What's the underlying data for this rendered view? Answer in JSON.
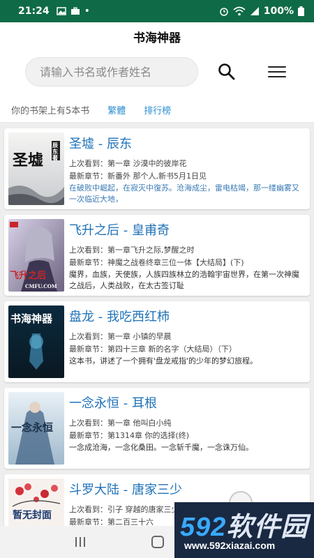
{
  "status_bar": {
    "time": "21:24",
    "battery": "100%",
    "dot": "•"
  },
  "app": {
    "title": "书海神器"
  },
  "search": {
    "placeholder": "请输入书名或作者姓名"
  },
  "shelf": {
    "count_text": "你的书架上有5本书",
    "traditional": "繁體",
    "ranking": "排行榜"
  },
  "books": [
    {
      "title": "圣墟 - 辰东",
      "last_read": "上次看到：第一章 沙漠中的彼岸花",
      "latest": "最新章节：新番外 那个人,新书5月1日见",
      "desc": "在破败中崛起，在寂灭中復苏。沧海成尘，雷电枯竭，那一缕幽雾又一次临近大地，",
      "cover_text": "圣墟",
      "cover_sub": "辰东著"
    },
    {
      "title": "飞升之后 - 皇甫奇",
      "last_read": "上次看到：第一章飞升之际,梦醒之时",
      "latest": "最新章节：神魔之战卷终章三位一体【大结局】(下)",
      "desc": "魔界，血族，天使族，人族四族林立的浩翰宇宙世界，在第一次神魔之战后，人类战败，在太古签订耻",
      "cover_text": "飞升之后",
      "cover_sub": "CMFU.COM"
    },
    {
      "title": "盘龙 - 我吃西红柿",
      "last_read": "上次看到：第一章 小镇的早晨",
      "latest": "最新章节：第四十三章 新的名字（大结局）（下）",
      "desc": "这本书，讲述了一个拥有'盘龙戒指'的少年的梦幻旅程。",
      "cover_text": "书海神器"
    },
    {
      "title": "一念永恒 - 耳根",
      "last_read": "上次看到：第一章 他叫白小纯",
      "latest": "最新章节：第1314章 你的选择(终)",
      "desc": "一念成沧海，一念化桑田。一念斩千魔，一念诛万仙。",
      "cover_text": "一念永恒"
    },
    {
      "title": "斗罗大陆 - 唐家三少",
      "last_read": "上次看到：引子 穿越的唐家三少",
      "latest": "最新章节：第二百三十六",
      "desc": "",
      "cover_text": "暂无封面"
    }
  ],
  "watermark": {
    "logo_num": "592",
    "logo_text": "软件园",
    "url": "www.592xiazai.com"
  }
}
